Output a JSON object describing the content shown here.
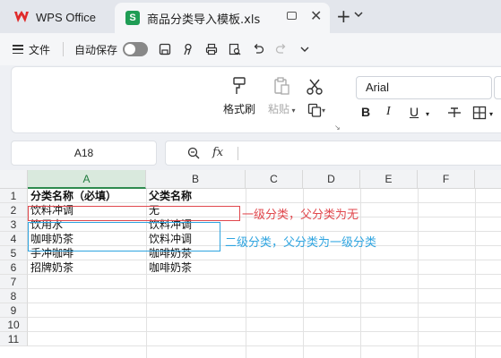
{
  "tabs": {
    "app_label": "WPS Office",
    "file_label": "商品分类导入模板.xls",
    "sheet_icon_letter": "S"
  },
  "qat": {
    "file_menu": "文件",
    "autosave": "自动保存",
    "autosave_on": false
  },
  "ribbon": {
    "format_painter": "格式刷",
    "paste": "粘贴",
    "font_name": "Arial",
    "bold": "B",
    "italic": "I",
    "underline": "U"
  },
  "formula_bar": {
    "name_box": "A18",
    "fx": "fx",
    "formula": ""
  },
  "sheet": {
    "active_column": "A",
    "columns": [
      "A",
      "B",
      "C",
      "D",
      "E",
      "F"
    ],
    "rows": [
      "1",
      "2",
      "3",
      "4",
      "5",
      "6",
      "7",
      "8",
      "9",
      "10",
      "11"
    ],
    "cells": [
      {
        "a": "分类名称（必填）",
        "b": "父类名称"
      },
      {
        "a": "饮料冲调",
        "b": "无"
      },
      {
        "a": "饮用水",
        "b": "饮料冲调"
      },
      {
        "a": "咖啡奶茶",
        "b": "饮料冲调"
      },
      {
        "a": "手冲咖啡",
        "b": "咖啡奶茶"
      },
      {
        "a": "招牌奶茶",
        "b": "咖啡奶茶"
      }
    ]
  },
  "annotations": {
    "red_note": "一级分类，父分类为无",
    "blue_note": "二级分类，父分类为一级分类",
    "red_color": "#e0474c",
    "blue_color": "#2ea4e0"
  },
  "colors": {
    "accent_green": "#1f9d55",
    "wps_red": "#e02b2b"
  }
}
